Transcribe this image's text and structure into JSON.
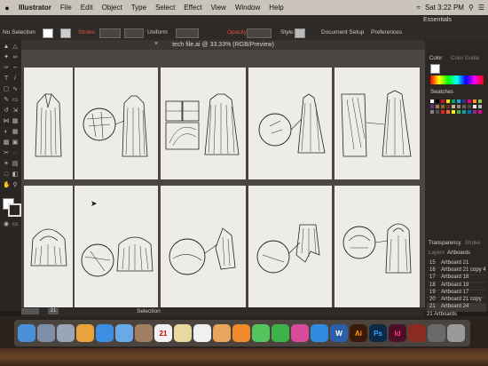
{
  "menubar": {
    "apple": "",
    "items": [
      "Illustrator",
      "File",
      "Edit",
      "Object",
      "Type",
      "Select",
      "Effect",
      "View",
      "Window",
      "Help"
    ],
    "clock": "Sat 3:22 PM"
  },
  "control_bar": {
    "essentials": "Essentials",
    "selection_label": "No Selection",
    "stroke_label": "Stroke:",
    "stroke_style": "Uniform",
    "opacity_label": "Opacity:",
    "style_label": "Style:",
    "document_setup": "Document Setup",
    "preferences": "Preferences"
  },
  "document": {
    "tab_title": "tech file.ai @ 33.33% (RGB/Preview)",
    "close": "×"
  },
  "canvas": {
    "artboards": [
      {
        "figure": "sleeveless-long-vest"
      },
      {
        "figure": "vest-with-detail-circle"
      },
      {
        "figure": "cape-with-pattern-boxes"
      },
      {
        "figure": "flared-cape-with-detail-circle"
      },
      {
        "figure": "long-coat-with-zoom-detail"
      },
      {
        "figure": "hooded-capelet"
      },
      {
        "figure": "poncho-with-detail-circle"
      },
      {
        "figure": "asymmetric-wrap-with-detail-circle"
      },
      {
        "figure": "draped-top-with-detail-circle"
      },
      {
        "figure": "hooded-jacket-with-detail-circle"
      }
    ]
  },
  "panels": {
    "color_tabs": [
      "Color",
      "Color Guide"
    ],
    "swatches_label": "Swatches",
    "swatch_colors": [
      "#ffffff",
      "#000000",
      "#c8102e",
      "#ffe000",
      "#00a651",
      "#00aeef",
      "#2e3192",
      "#ec008c",
      "#f7941d",
      "#8dc63f",
      "#662d91",
      "#a67c52",
      "#8c6239",
      "#603813",
      "#c7b299",
      "#998675",
      "#736357",
      "#534741",
      "#e6e6e6",
      "#b3b3b3",
      "#808080",
      "#4d4d4d",
      "#ed1c24",
      "#f26522",
      "#fff200",
      "#39b54a",
      "#00a99d",
      "#0072bc",
      "#92278f",
      "#ec008c"
    ],
    "transparency_tab": "Transparency",
    "transparency_tab2": "Stroke",
    "layers_tabs": [
      "Layers",
      "Artboards"
    ],
    "artboard_rows": [
      {
        "num": "15",
        "name": "Artboard 21"
      },
      {
        "num": "16",
        "name": "Artboard 21 copy 4"
      },
      {
        "num": "17",
        "name": "Artboard 18"
      },
      {
        "num": "18",
        "name": "Artboard 19"
      },
      {
        "num": "19",
        "name": "Artboard 17"
      },
      {
        "num": "20",
        "name": "Artboard 21 copy"
      },
      {
        "num": "21",
        "name": "Artboard 24"
      }
    ],
    "artboard_count": "21 Artboards"
  },
  "status": {
    "tool": "Selection",
    "artboard_num": "21"
  },
  "dock": {
    "icons": [
      {
        "name": "finder-icon",
        "label": "",
        "color": "#4a90d9"
      },
      {
        "name": "launchpad-icon",
        "label": "",
        "color": "#7d8fa8"
      },
      {
        "name": "rocket-icon",
        "label": "",
        "color": "#9aa5b5"
      },
      {
        "name": "chrome-icon",
        "label": "",
        "color": "#e8a33a"
      },
      {
        "name": "safari-icon",
        "label": "",
        "color": "#3c8ee0"
      },
      {
        "name": "mail-icon",
        "label": "",
        "color": "#6aa9e8"
      },
      {
        "name": "photo-icon",
        "label": "",
        "color": "#a08060"
      },
      {
        "name": "calendar-icon",
        "label": "21",
        "color": "#f2f2f2"
      },
      {
        "name": "notes-icon",
        "label": "",
        "color": "#e8d9a0"
      },
      {
        "name": "reminders-icon",
        "label": "",
        "color": "#f0f0f0"
      },
      {
        "name": "photos-icon",
        "label": "",
        "color": "#e9a55b"
      },
      {
        "name": "ibooks-icon",
        "label": "",
        "color": "#f08a2a"
      },
      {
        "name": "messages-icon",
        "label": "",
        "color": "#56c45c"
      },
      {
        "name": "facetime-icon",
        "label": "",
        "color": "#3cb34a"
      },
      {
        "name": "itunes-icon",
        "label": "",
        "color": "#d84a9a"
      },
      {
        "name": "appstore-icon",
        "label": "",
        "color": "#2f8be0"
      },
      {
        "name": "word-icon",
        "label": "W",
        "color": "#2b5faa"
      },
      {
        "name": "illustrator-icon",
        "label": "Ai",
        "color": "#3a1a0a"
      },
      {
        "name": "photoshop-icon",
        "label": "Ps",
        "color": "#0c2a45"
      },
      {
        "name": "indesign-icon",
        "label": "Id",
        "color": "#4a0f26"
      },
      {
        "name": "misc-icon",
        "label": "",
        "color": "#8a2a20"
      },
      {
        "name": "preview-icon",
        "label": "",
        "color": "#6a6a6a"
      },
      {
        "name": "trash-icon",
        "label": "",
        "color": "#9a9a9a"
      }
    ]
  }
}
